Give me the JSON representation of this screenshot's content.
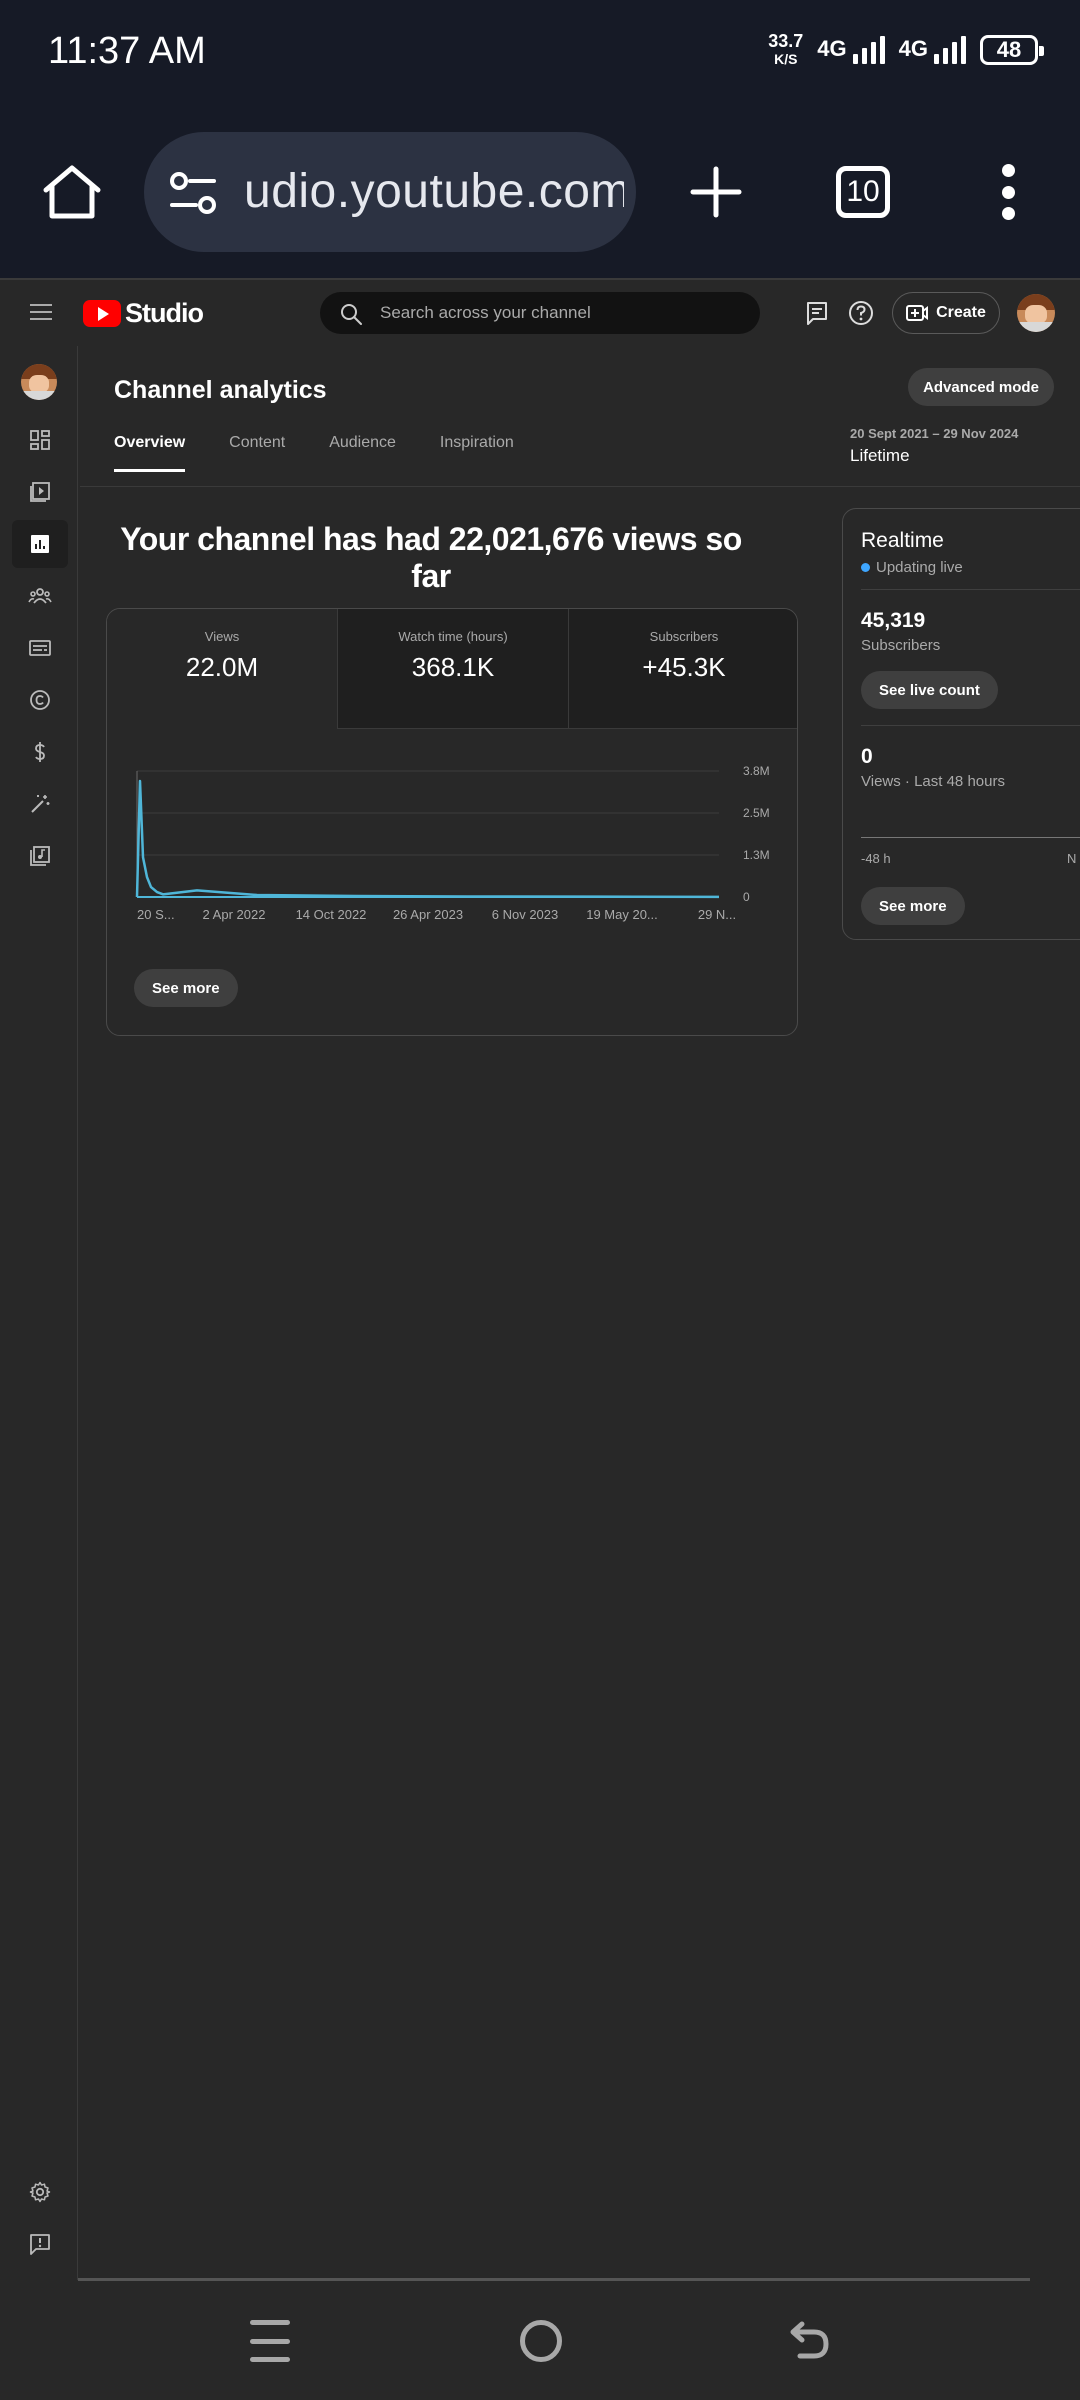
{
  "status_bar": {
    "time": "11:37 AM",
    "net_speed": "33.7",
    "net_unit": "K/S",
    "signal_1": "4G",
    "signal_2": "4G",
    "battery": "48"
  },
  "browser": {
    "url": "udio.youtube.com",
    "tab_count": "10"
  },
  "header": {
    "logo_text": "Studio",
    "search_placeholder": "Search across your channel",
    "create_label": "Create"
  },
  "page": {
    "title": "Channel analytics",
    "advanced_mode_label": "Advanced mode",
    "tabs": [
      {
        "label": "Overview",
        "active": true
      },
      {
        "label": "Content",
        "active": false
      },
      {
        "label": "Audience",
        "active": false
      },
      {
        "label": "Inspiration",
        "active": false
      }
    ],
    "date_range": "20 Sept 2021 – 29 Nov 2024",
    "date_label": "Lifetime",
    "headline": "Your channel has had 22,021,676 views so far"
  },
  "metrics": [
    {
      "label": "Views",
      "value": "22.0M"
    },
    {
      "label": "Watch time (hours)",
      "value": "368.1K"
    },
    {
      "label": "Subscribers",
      "value": "+45.3K"
    }
  ],
  "chart_see_more": "See more",
  "realtime": {
    "title": "Realtime",
    "status": "Updating live",
    "subscribers_value": "45,319",
    "subscribers_label": "Subscribers",
    "live_count_label": "See live count",
    "views_value": "0",
    "views_label": "Views · Last 48 hours",
    "axis_start": "-48 h",
    "axis_end": "N",
    "see_more": "See more"
  },
  "colors": {
    "accent_line": "#4fb6d8",
    "live_dot": "#3ea6ff",
    "brand_red": "#ff0000"
  },
  "chart_data": {
    "type": "line",
    "x": [
      "20 S...",
      "",
      "",
      "",
      "",
      "",
      "",
      "2 Apr 2022",
      "14 Oct 2022",
      "26 Apr 2023",
      "6 Nov 2023",
      "19 May 20...",
      "29 N..."
    ],
    "x_tick_labels": [
      "20 S...",
      "2 Apr 2022",
      "14 Oct 2022",
      "26 Apr 2023",
      "6 Nov 2023",
      "19 May 20...",
      "29 N..."
    ],
    "y_tick_labels": [
      "3.8M",
      "2.5M",
      "1.3M",
      "0"
    ],
    "ylim": [
      0,
      3800000
    ],
    "series": [
      {
        "values": [
          0,
          3500000,
          1200000,
          600000,
          300000,
          150000,
          80000,
          200000,
          60000,
          30000,
          15000,
          10000,
          5000
        ]
      }
    ],
    "grid": true,
    "title": "",
    "xlabel": "",
    "ylabel": ""
  }
}
